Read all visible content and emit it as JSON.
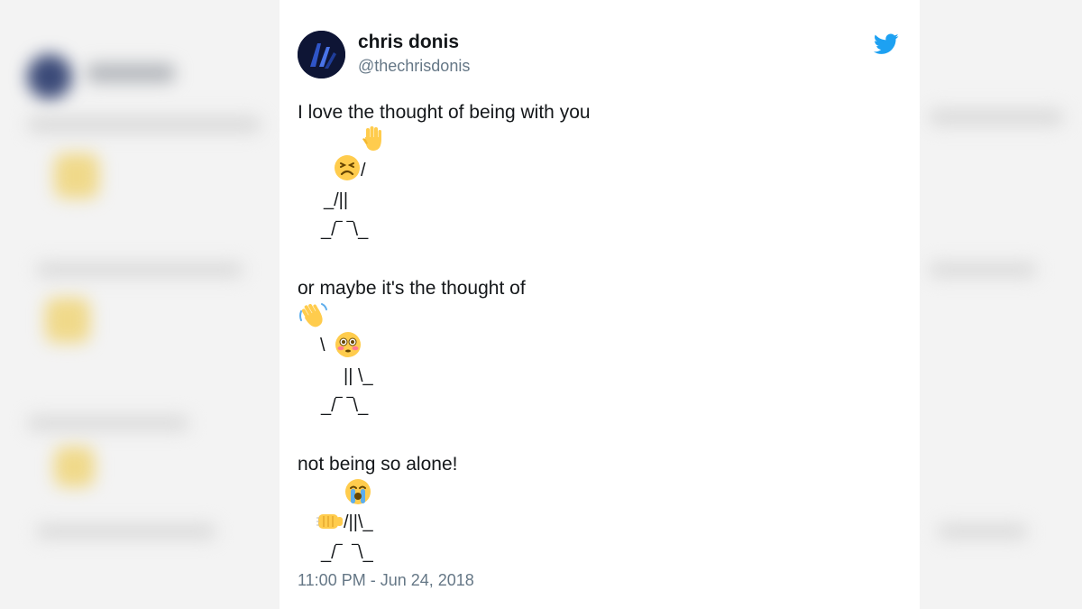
{
  "tweet": {
    "display_name": "chris donis",
    "handle": "@thechrisdonis",
    "line1": "I love the thought of being with you",
    "line2": "or maybe it's the thought of",
    "line3": "not being so alone!",
    "timestamp": "11:00 PM - Jun 24, 2018",
    "figure1": {
      "row2": "/",
      "row3": "_/||",
      "row4": "_/‾ ‾\\_"
    },
    "figure2": {
      "row2": "\\",
      "row3": "|| \\_",
      "row4": "_/‾ ‾\\_"
    },
    "figure3": {
      "row2": "/||\\_",
      "row3": "_/‾  ‾\\_"
    }
  },
  "icons": {
    "brand": "twitter-bird-icon",
    "figure1": [
      "raised-hand-icon",
      "persevering-face-icon"
    ],
    "figure2": [
      "waving-hand-icon",
      "flushed-face-icon"
    ],
    "figure3": [
      "crying-face-icon",
      "fist-bump-icon"
    ]
  },
  "colors": {
    "brand": "#1da1f2",
    "secondary_text": "#657786",
    "primary_text": "#14171a"
  }
}
